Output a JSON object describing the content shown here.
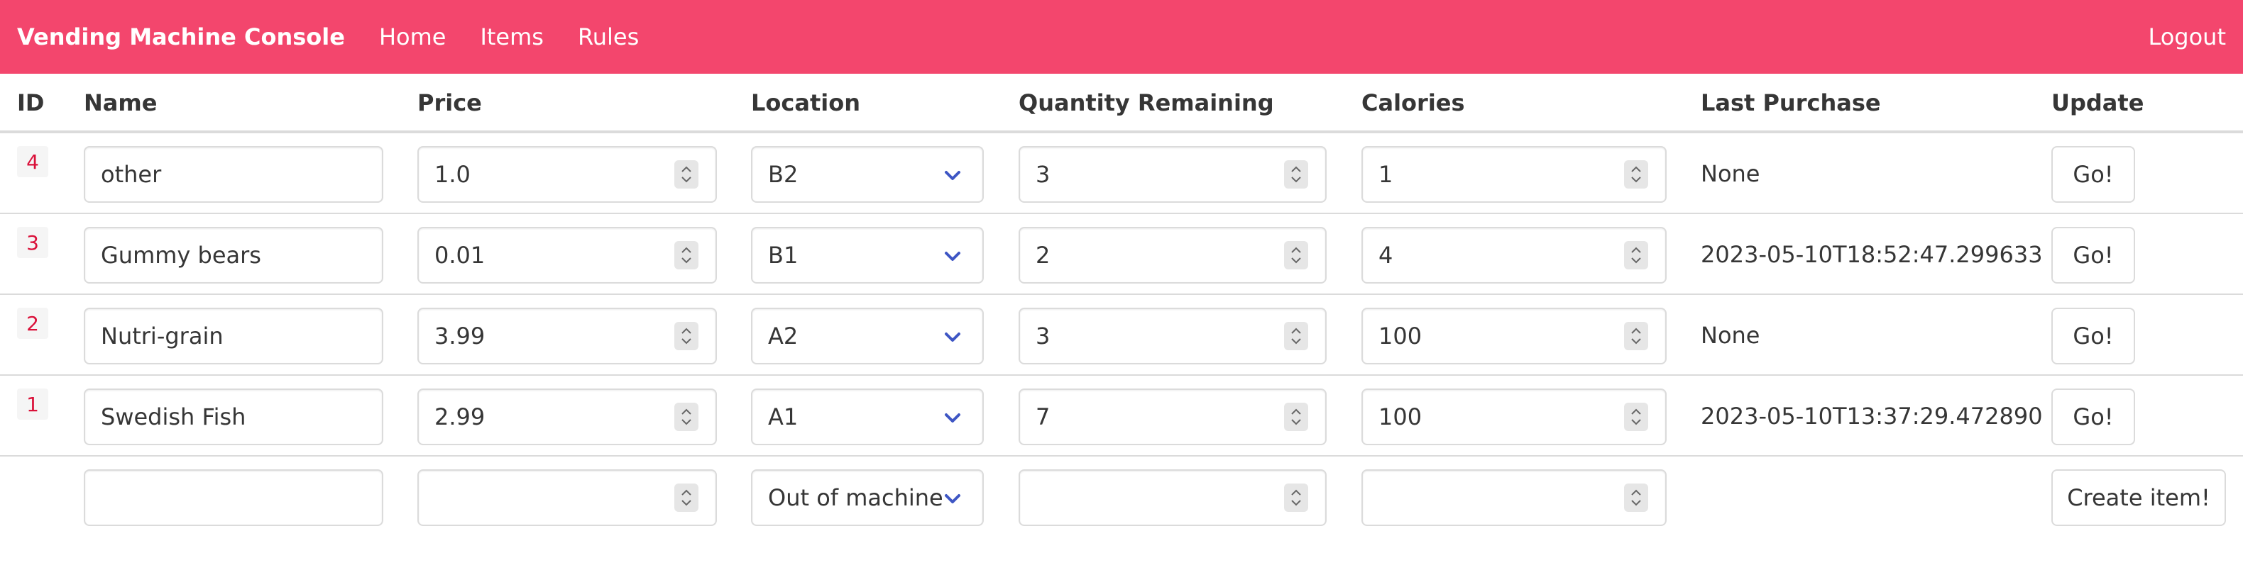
{
  "navbar": {
    "brand": "Vending Machine Console",
    "links": [
      {
        "label": "Home"
      },
      {
        "label": "Items"
      },
      {
        "label": "Rules"
      }
    ],
    "logout": "Logout"
  },
  "table": {
    "headers": {
      "id": "ID",
      "name": "Name",
      "price": "Price",
      "location": "Location",
      "quantity": "Quantity Remaining",
      "calories": "Calories",
      "last_purchase": "Last Purchase",
      "update": "Update"
    },
    "rows": [
      {
        "id": "4",
        "name": "other",
        "price": "1.0",
        "location": "B2",
        "quantity": "3",
        "calories": "1",
        "last_purchase": "None",
        "button": "Go!"
      },
      {
        "id": "3",
        "name": "Gummy bears",
        "price": "0.01",
        "location": "B1",
        "quantity": "2",
        "calories": "4",
        "last_purchase": "2023-05-10T18:52:47.299633",
        "button": "Go!"
      },
      {
        "id": "2",
        "name": "Nutri-grain",
        "price": "3.99",
        "location": "A2",
        "quantity": "3",
        "calories": "100",
        "last_purchase": "None",
        "button": "Go!"
      },
      {
        "id": "1",
        "name": "Swedish Fish",
        "price": "2.99",
        "location": "A1",
        "quantity": "7",
        "calories": "100",
        "last_purchase": "2023-05-10T13:37:29.472890",
        "button": "Go!"
      }
    ],
    "new_row": {
      "name": "",
      "price": "",
      "location": "Out of machine",
      "quantity": "",
      "calories": "",
      "button": "Create item!"
    }
  },
  "colors": {
    "navbar": "#f3466d",
    "id_text": "#da1039",
    "chevron": "#3e56c4"
  }
}
